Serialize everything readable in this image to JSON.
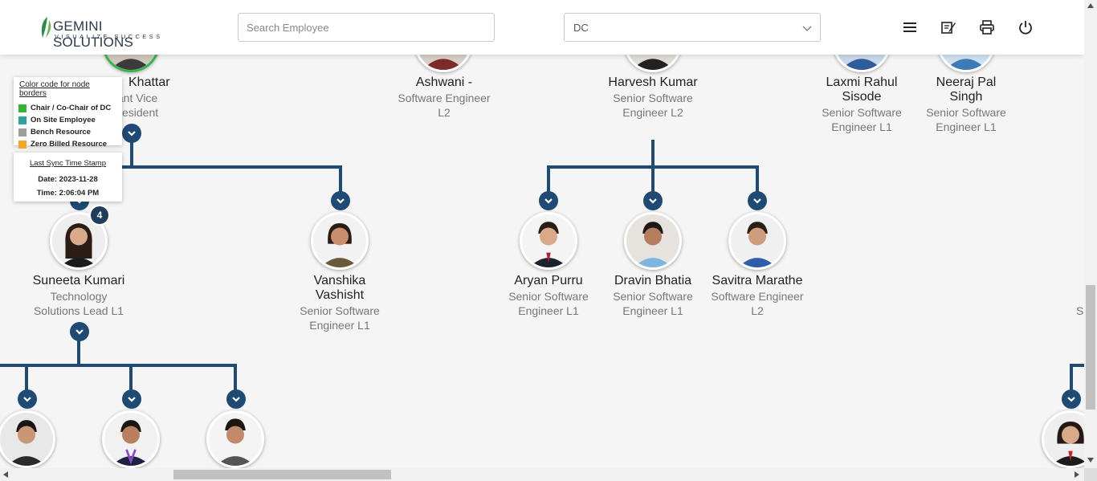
{
  "header": {
    "brand": "GEMINI SOLUTIONS",
    "tagline": "VISUALIZE SUCCESS",
    "search_placeholder": "Search Employee",
    "department": "DC",
    "icons": [
      "menu-icon",
      "notes-icon",
      "printer-icon",
      "power-icon"
    ]
  },
  "legend": {
    "title": "Color code for node borders",
    "items": [
      {
        "label": "Chair / Co-Chair of DC",
        "color": "#2eb82e"
      },
      {
        "label": "On Site Employee",
        "color": "#30a0a0"
      },
      {
        "label": "Bench Resource",
        "color": "#9e9e9e"
      },
      {
        "label": "Zero Billed Resource",
        "color": "#f5a623"
      }
    ]
  },
  "sync": {
    "title": "Last Sync Time Stamp",
    "date": "Date: 2023-11-28",
    "time": "Time: 2:06:04 PM"
  },
  "nodes": [
    {
      "name": "Khattar",
      "role_line1": "tant Vice",
      "role_line2": "esident"
    },
    {
      "name": "Ashwani -",
      "role_line1": "Software Engineer",
      "role_line2": "L2"
    },
    {
      "name": "Harvesh Kumar",
      "role_line1": "Senior Software",
      "role_line2": "Engineer L2"
    },
    {
      "name_line1": "Laxmi Rahul",
      "name_line2": "Sisode",
      "role_line1": "Senior Software",
      "role_line2": "Engineer L1"
    },
    {
      "name_line1": "Neeraj Pal",
      "name_line2": "Singh",
      "role_line1": "Senior Software",
      "role_line2": "Engineer L1"
    },
    {
      "name": "Suneeta Kumari",
      "role_line1": "Technology",
      "role_line2": "Solutions Lead L1",
      "badge": "4"
    },
    {
      "name_line1": "Vanshika",
      "name_line2": "Vashisht",
      "role_line1": "Senior Software",
      "role_line2": "Engineer L1"
    },
    {
      "name": "Aryan Purru",
      "role_line1": "Senior Software",
      "role_line2": "Engineer L1"
    },
    {
      "name": "Dravin Bhatia",
      "role_line1": "Senior Software",
      "role_line2": "Engineer L1"
    },
    {
      "name": "Savitra Marathe",
      "role_line1": "Software Engineer",
      "role_line2": "L2"
    },
    {
      "role_fragment": "S"
    }
  ],
  "colors": {
    "connector": "#1f4a73",
    "chair_border": "#3ab54a"
  }
}
